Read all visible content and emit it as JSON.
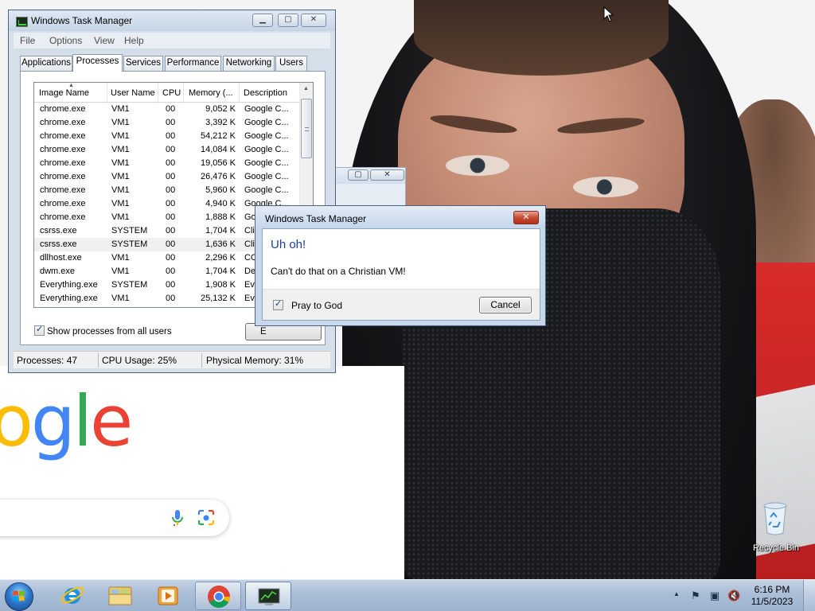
{
  "colors": {
    "window_frame": "#d5dfea",
    "dialog_heading": "#1e3f9a",
    "taskbar": "#a9bdd6",
    "close_red": "#c94a33",
    "google_blue": "#4285f4",
    "google_red": "#ea4335",
    "google_yellow": "#fbbc05",
    "google_green": "#34a853"
  },
  "desktop": {
    "background": "photo of a person wearing a black hood and face mask",
    "google_logo_visible": [
      "o",
      "g",
      "l",
      "e"
    ],
    "recycle_bin_label": "Recycle Bin"
  },
  "task_manager": {
    "title": "Windows Task Manager",
    "menu": [
      "File",
      "Options",
      "View",
      "Help"
    ],
    "tabs": [
      "Applications",
      "Processes",
      "Services",
      "Performance",
      "Networking",
      "Users"
    ],
    "active_tab": "Processes",
    "columns": [
      "Image Name",
      "User Name",
      "CPU",
      "Memory (...",
      "Description"
    ],
    "rows": [
      {
        "name": "chrome.exe",
        "user": "VM1",
        "cpu": "00",
        "mem": "9,052 K",
        "desc": "Google C..."
      },
      {
        "name": "chrome.exe",
        "user": "VM1",
        "cpu": "00",
        "mem": "3,392 K",
        "desc": "Google C..."
      },
      {
        "name": "chrome.exe",
        "user": "VM1",
        "cpu": "00",
        "mem": "54,212 K",
        "desc": "Google C..."
      },
      {
        "name": "chrome.exe",
        "user": "VM1",
        "cpu": "00",
        "mem": "14,084 K",
        "desc": "Google C..."
      },
      {
        "name": "chrome.exe",
        "user": "VM1",
        "cpu": "00",
        "mem": "19,056 K",
        "desc": "Google C..."
      },
      {
        "name": "chrome.exe",
        "user": "VM1",
        "cpu": "00",
        "mem": "26,476 K",
        "desc": "Google C..."
      },
      {
        "name": "chrome.exe",
        "user": "VM1",
        "cpu": "00",
        "mem": "5,960 K",
        "desc": "Google C..."
      },
      {
        "name": "chrome.exe",
        "user": "VM1",
        "cpu": "00",
        "mem": "4,940 K",
        "desc": "Google C..."
      },
      {
        "name": "chrome.exe",
        "user": "VM1",
        "cpu": "00",
        "mem": "1,888 K",
        "desc": "Goo"
      },
      {
        "name": "csrss.exe",
        "user": "SYSTEM",
        "cpu": "00",
        "mem": "1,704 K",
        "desc": "Clie"
      },
      {
        "name": "csrss.exe",
        "user": "SYSTEM",
        "cpu": "00",
        "mem": "1,636 K",
        "desc": "Clie"
      },
      {
        "name": "dllhost.exe",
        "user": "VM1",
        "cpu": "00",
        "mem": "2,296 K",
        "desc": "CO"
      },
      {
        "name": "dwm.exe",
        "user": "VM1",
        "cpu": "00",
        "mem": "1,704 K",
        "desc": "Des"
      },
      {
        "name": "Everything.exe",
        "user": "SYSTEM",
        "cpu": "00",
        "mem": "1,908 K",
        "desc": "Eve"
      },
      {
        "name": "Everything.exe",
        "user": "VM1",
        "cpu": "00",
        "mem": "25,132 K",
        "desc": "Eve"
      }
    ],
    "show_all_label": "Show processes from all users",
    "show_all_checked": true,
    "end_process_label": "E",
    "status": {
      "processes": "Processes: 47",
      "cpu": "CPU Usage: 25%",
      "memory": "Physical Memory: 31%"
    }
  },
  "dialog": {
    "title": "Windows Task Manager",
    "heading": "Uh oh!",
    "message": "Can't do that on a Christian VM!",
    "checkbox_label": "Pray to God",
    "checkbox_checked": true,
    "cancel_label": "Cancel"
  },
  "taskbar": {
    "pinned": [
      "windows-explorer",
      "internet-explorer",
      "file-explorer",
      "media-player",
      "google-chrome",
      "task-manager"
    ],
    "time": "6:16 PM",
    "date": "11/5/2023"
  }
}
